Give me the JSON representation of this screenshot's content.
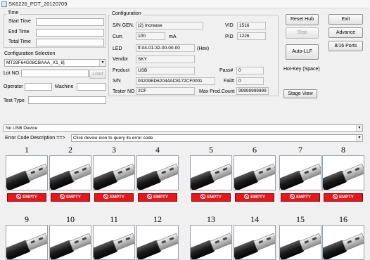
{
  "window": {
    "title": "SK6226_PDT_20120709"
  },
  "time": {
    "group_title": "Time",
    "start_label": "Start Time",
    "start_value": "",
    "end_label": "End Time",
    "end_value": "",
    "total_label": "Total Time",
    "total_value": ""
  },
  "config_sel": {
    "group_title": "Configuration Selection",
    "selected": "MT29F64G08CBAAA_X1_8]",
    "lot_label": "Lot NO",
    "lot_value": "",
    "load_label": "Load",
    "operator_label": "Operator",
    "operator_value": "",
    "machine_label": "Machine",
    "machine_value": "",
    "test_type_label": "Test Type",
    "test_type_value": ""
  },
  "configuration": {
    "group_title": "Configuration",
    "sn_gen_label": "S/N GEN.",
    "sn_gen_value": "(2) Increase",
    "curr_label": "Curr.",
    "curr_value": "100",
    "curr_unit": "mA",
    "led_label": "LED",
    "led_value": "ff-04-01-32-00-00-00",
    "led_unit": "(Hex)",
    "vendor_label": "Vendor",
    "vendor_value": "SKY",
    "product_label": "Product",
    "product_value": "USB",
    "sn_label": "S/N",
    "sn_value": "00209ED62044AC8172CF0001",
    "tester_label": "Tester NO",
    "tester_value": "2CF",
    "vid_label": "VID",
    "vid_value": "1516",
    "pid_label": "PID",
    "pid_value": "1226",
    "pass_label": "Pass#",
    "pass_value": "0",
    "fail_label": "Fail#",
    "fail_value": "0",
    "max_label": "Max Prod.Count",
    "max_value": "99999999999"
  },
  "buttons": {
    "reset_hub": "Reset Hub",
    "stop": "Stop",
    "auto_llf": "Auto-LLF",
    "hotkey": "Hot-Key (Space)",
    "stage_view": "Stage View",
    "exit": "Exit",
    "advance": "Advance",
    "ports": "8/16 Ports"
  },
  "device": {
    "status": "No USB Device",
    "error_label": "Error Code Description ==>",
    "error_value": "Click device icon to query its error code"
  },
  "slots": [
    {
      "num": "1",
      "status": "EMPTY"
    },
    {
      "num": "2",
      "status": "EMPTY"
    },
    {
      "num": "3",
      "status": "EMPTY"
    },
    {
      "num": "4",
      "status": "EMPTY"
    },
    {
      "num": "5",
      "status": "EMPTY"
    },
    {
      "num": "6",
      "status": "EMPTY"
    },
    {
      "num": "7",
      "status": "EMPTY"
    },
    {
      "num": "8",
      "status": "EMPTY"
    },
    {
      "num": "9"
    },
    {
      "num": "10"
    },
    {
      "num": "11"
    },
    {
      "num": "12"
    },
    {
      "num": "13"
    },
    {
      "num": "14"
    },
    {
      "num": "15"
    },
    {
      "num": "16"
    }
  ],
  "colors": {
    "empty_status": "#e8161c",
    "window_bg": "#f0f0f0"
  }
}
